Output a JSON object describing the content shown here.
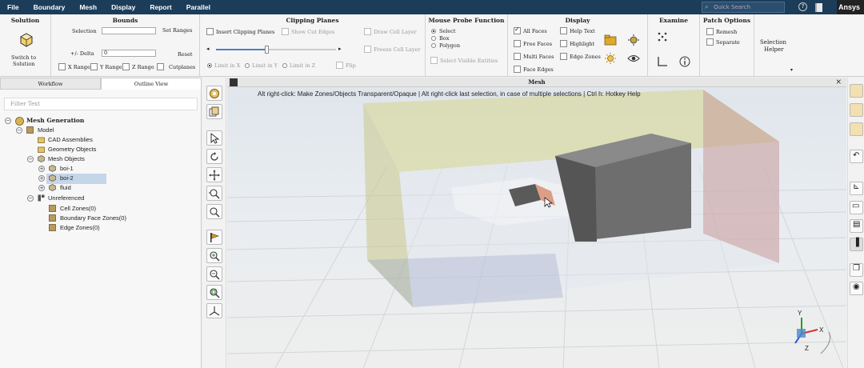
{
  "menubar": {
    "items": [
      "File",
      "Boundary",
      "Mesh",
      "Display",
      "Report",
      "Parallel"
    ],
    "search_placeholder": "Quick Search",
    "brand": "Ansys"
  },
  "ribbon": {
    "solution": {
      "title": "Solution",
      "switch_label_1": "Switch to",
      "switch_label_2": "Solution"
    },
    "bounds": {
      "title": "Bounds",
      "selection_label": "Selection",
      "set_ranges": "Set Ranges",
      "delta_label": "+/- Delta",
      "delta_value": "0",
      "reset": "Reset",
      "x_range": "X Range",
      "y_range": "Y Range",
      "z_range": "Z Range",
      "cutplanes": "Cutplanes"
    },
    "clipping": {
      "title": "Clipping Planes",
      "insert": "Insert Clipping Planes",
      "show_cut_edges": "Show Cut Edges",
      "draw_cell_layer": "Draw Cell Layer",
      "freeze_cell_layer": "Freeze Cell Layer",
      "limit_x": "Limit in X",
      "limit_y": "Limit in Y",
      "limit_z": "Limit in Z",
      "flip": "Flip",
      "slider_position": 0.42
    },
    "probe": {
      "title": "Mouse Probe Function",
      "select": "Select",
      "box": "Box",
      "polygon": "Polygon",
      "select_visible": "Select Visible Entities"
    },
    "display": {
      "title": "Display",
      "all_faces": "All Faces",
      "help_text": "Help Text",
      "free_faces": "Free Faces",
      "highlight": "Highlight",
      "multi_faces": "Multi Faces",
      "edge_zones": "Edge Zones",
      "face_edges": "Face Edges"
    },
    "examine": {
      "title": "Examine"
    },
    "patch": {
      "title": "Patch Options",
      "remesh": "Remesh",
      "separate": "Separate"
    },
    "selection_helper_1": "Selection",
    "selection_helper_2": "Helper"
  },
  "leftpanel": {
    "tabs": [
      "Workflow",
      "Outline View"
    ],
    "filter_placeholder": "Filter Text",
    "tree": {
      "root": "Mesh Generation",
      "model": "Model",
      "cad": "CAD Assemblies",
      "geometry": "Geometry Objects",
      "mesh_objects": "Mesh Objects",
      "boi1": "boi-1",
      "boi2": "boi-2",
      "fluid": "fluid",
      "unreferenced": "Unreferenced",
      "cell_zones": "Cell Zones(0)",
      "boundary_face_zones": "Boundary Face Zones(0)",
      "edge_zones": "Edge Zones(0)"
    }
  },
  "viewport": {
    "title": "Mesh",
    "close": "×",
    "hint": "Alt right-click: Make Zones/Objects Transparent/Opaque | Alt right-click last selection, in case of multiple selections | Ctrl h: Hotkey Help",
    "axis_x": "X",
    "axis_y": "Y",
    "axis_z": "Z"
  },
  "colors": {
    "menubar": "#1c3d5a",
    "fluid_yellow": "#d8d68a",
    "fluid_red": "#c99a9a",
    "fluid_blue": "#9aa6c8",
    "block_gray": "#6e6e6e",
    "selection": "#c4d6e8"
  }
}
